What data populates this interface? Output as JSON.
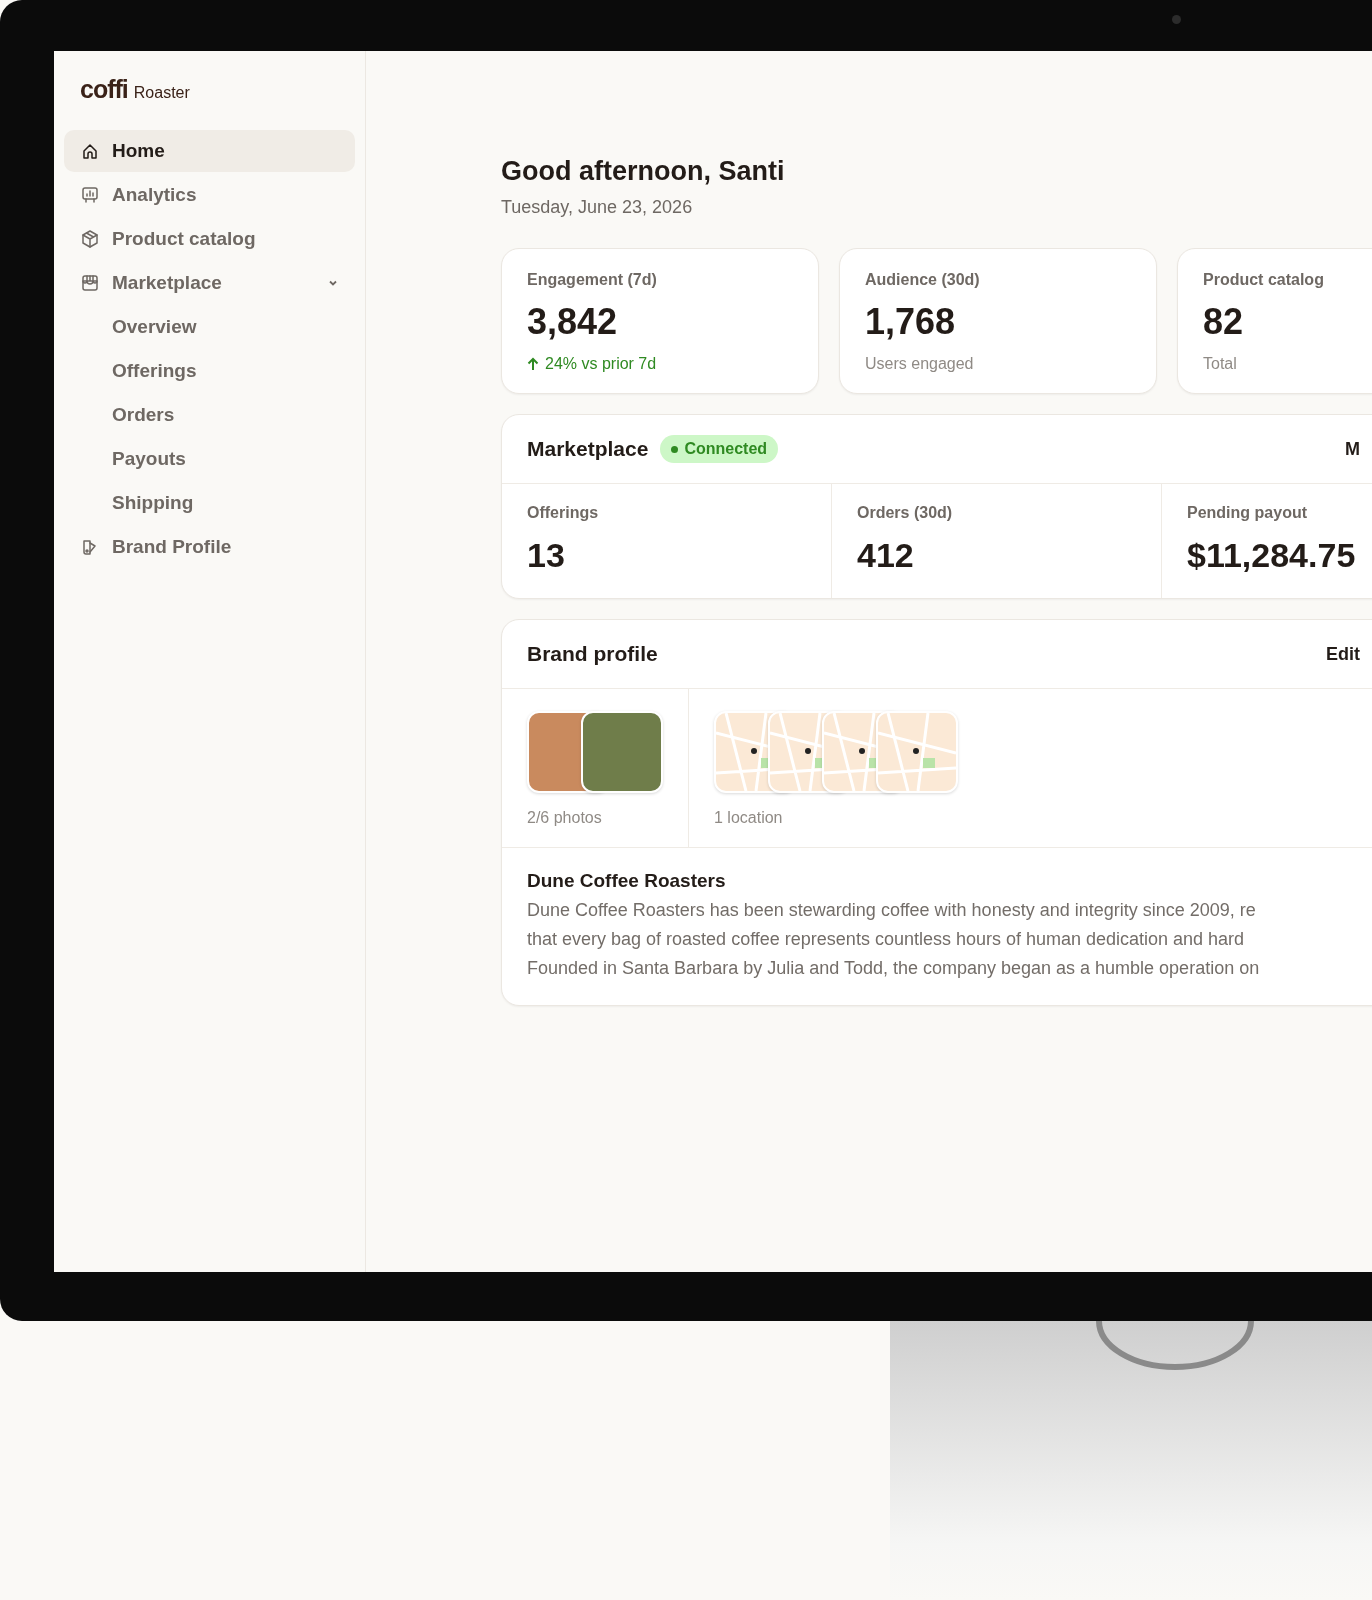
{
  "brand": {
    "logo": "coffi",
    "product": "Roaster"
  },
  "sidebar": {
    "items": [
      {
        "label": "Home",
        "selected": true
      },
      {
        "label": "Analytics",
        "selected": false
      },
      {
        "label": "Product catalog",
        "selected": false
      },
      {
        "label": "Marketplace",
        "selected": false,
        "expanded": true,
        "children": [
          {
            "label": "Overview",
            "selected": false
          },
          {
            "label": "Offerings",
            "selected": false
          },
          {
            "label": "Orders",
            "selected": false
          },
          {
            "label": "Payouts",
            "selected": false
          },
          {
            "label": "Shipping",
            "selected": false
          }
        ]
      },
      {
        "label": "Brand Profile",
        "selected": false
      }
    ]
  },
  "header": {
    "greeting": "Good afternoon, Santi",
    "date": "Tuesday, June 23, 2026"
  },
  "stats": [
    {
      "label": "Engagement (7d)",
      "value": "3,842",
      "note": "24% vs prior 7d",
      "kind": "trend"
    },
    {
      "label": "Audience (30d)",
      "value": "1,768",
      "note": "Users engaged",
      "kind": "plain"
    },
    {
      "label": "Product catalog",
      "value": "82",
      "note": "Total",
      "kind": "plain"
    }
  ],
  "marketplace": {
    "title": "Marketplace",
    "status": {
      "label": "Connected",
      "color": "#2f8a22"
    },
    "action": "M",
    "metrics": [
      {
        "label": "Offerings",
        "value": "13"
      },
      {
        "label": "Orders (30d)",
        "value": "412"
      },
      {
        "label": "Pending payout",
        "value": "$11,284.75"
      }
    ]
  },
  "brand_profile": {
    "title": "Brand profile",
    "action": "Edit",
    "photos_caption": "2/6 photos",
    "location_caption": "1 location",
    "name": "Dune Coffee Roasters",
    "description_lines": [
      "Dune Coffee Roasters has been stewarding coffee with honesty and integrity since 2009, re",
      "that every bag of roasted coffee represents countless hours of human dedication and hard",
      "Founded in Santa Barbara by Julia and Todd, the company began as a humble operation on"
    ]
  }
}
